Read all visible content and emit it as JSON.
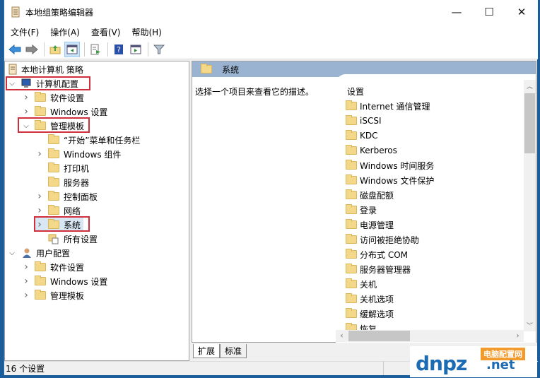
{
  "window": {
    "title": "本地组策略编辑器",
    "minimize_icon": "minimize-icon",
    "maximize_icon": "maximize-icon",
    "close_icon": "close-icon"
  },
  "menu": [
    "文件(F)",
    "操作(A)",
    "查看(V)",
    "帮助(H)"
  ],
  "toolbar": [
    {
      "icon": "back-arrow-icon"
    },
    {
      "icon": "forward-arrow-icon"
    },
    {
      "icon": "up-folder-icon"
    },
    {
      "icon": "show-hide-tree-icon",
      "active": true
    },
    {
      "icon": "export-list-icon"
    },
    {
      "icon": "help-icon"
    },
    {
      "icon": "show-hide-action-pane-icon"
    },
    {
      "icon": "filter-icon"
    }
  ],
  "tree": {
    "root": "本地计算机 策略",
    "items": [
      {
        "label": "计算机配置",
        "level": 1,
        "expanded": true,
        "icon": "computer-icon",
        "highlighted": true
      },
      {
        "label": "软件设置",
        "level": 2,
        "expandable": true
      },
      {
        "label": "Windows 设置",
        "level": 2,
        "expandable": true
      },
      {
        "label": "管理模板",
        "level": 2,
        "expanded": true,
        "highlighted": true
      },
      {
        "label": "“开始”菜单和任务栏",
        "level": 3,
        "expandable": false
      },
      {
        "label": "Windows 组件",
        "level": 3,
        "expandable": true
      },
      {
        "label": "打印机",
        "level": 3,
        "expandable": false
      },
      {
        "label": "服务器",
        "level": 3,
        "expandable": false
      },
      {
        "label": "控制面板",
        "level": 3,
        "expandable": true
      },
      {
        "label": "网络",
        "level": 3,
        "expandable": true
      },
      {
        "label": "系统",
        "level": 3,
        "expandable": true,
        "selected": true,
        "highlighted": true
      },
      {
        "label": "所有设置",
        "level": 3,
        "expandable": false,
        "icon": "all-settings-icon"
      },
      {
        "label": "用户配置",
        "level": 1,
        "expanded": true,
        "icon": "user-icon"
      },
      {
        "label": "软件设置",
        "level": 2,
        "expandable": true
      },
      {
        "label": "Windows 设置",
        "level": 2,
        "expandable": true
      },
      {
        "label": "管理模板",
        "level": 2,
        "expandable": true
      }
    ]
  },
  "right": {
    "header": "系统",
    "description": "选择一个项目来查看它的描述。",
    "column_header": "设置",
    "items": [
      "Internet 通信管理",
      "iSCSI",
      "KDC",
      "Kerberos",
      "Windows 时间服务",
      "Windows 文件保护",
      "磁盘配额",
      "登录",
      "电源管理",
      "访问被拒绝协助",
      "分布式 COM",
      "服务器管理器",
      "关机",
      "关机选项",
      "缓解选项",
      "恢复"
    ]
  },
  "tabs": [
    {
      "label": "扩展",
      "active": true
    },
    {
      "label": "标准",
      "active": false
    }
  ],
  "status": "16 个设置",
  "watermark": {
    "main": "dnpz",
    "tag": "电脑配置网",
    "suffix": ".net"
  }
}
